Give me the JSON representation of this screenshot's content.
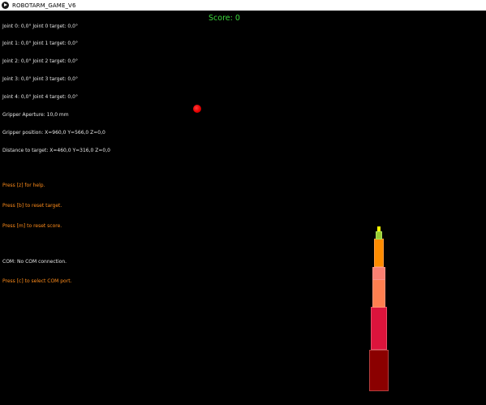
{
  "window": {
    "title": "ROBOTARM_GAME_V6"
  },
  "hud": {
    "joints": [
      "Joint 0: 0,0° Joint 0 target: 0,0°",
      "Joint 1: 0,0° Joint 1 target: 0,0°",
      "Joint 2: 0,0° Joint 2 target: 0,0°",
      "Joint 3: 0,0° Joint 3 target: 0,0°",
      "Joint 4: 0,0° Joint 4 target: 0,0°"
    ],
    "gripper_aperture": "Gripper Aperture: 10,0 mm",
    "gripper_position": "Gripper position: X=960,0 Y=566,0 Z=0,0",
    "distance_to_target": "Distance to target: X=460,0 Y=316,0 Z=0,0",
    "help_hint": "Press [z] for help.",
    "reset_target_hint": "Press [b] to reset target.",
    "reset_score_hint": "Press [m] to reset score.",
    "com_status": "COM: No COM connection.",
    "select_com_hint": "Press [c] to select COM port."
  },
  "score": {
    "label": "Score: 0"
  },
  "colors": {
    "hud_text": "#e6e6e6",
    "hint_text": "#ff8c1a",
    "score_text": "#3dd83d",
    "target": "#e60000",
    "base": "#8b0000",
    "segment_1": "#dc143c",
    "segment_2": "#ff7f50",
    "segment_2_top": "#fa8072",
    "segment_3": "#ff8c00",
    "gripper": "#9acd32",
    "gripper_tip": "#ffff00"
  }
}
